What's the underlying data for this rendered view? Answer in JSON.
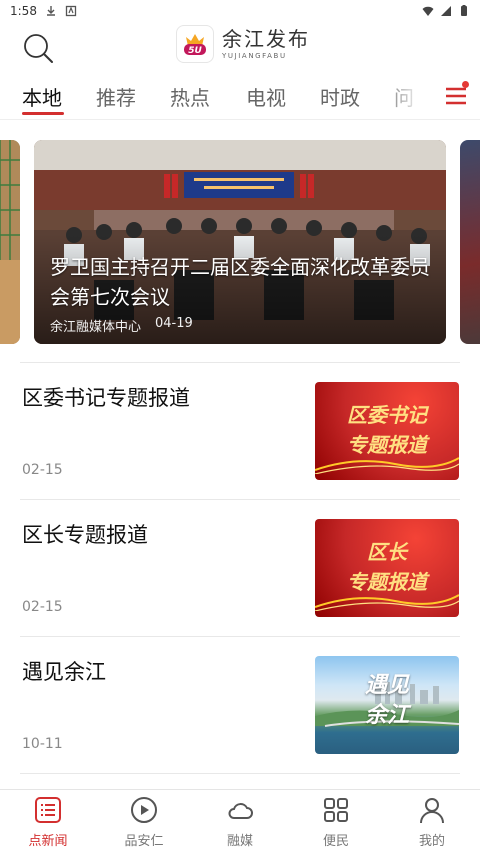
{
  "status_bar": {
    "time": "1:58"
  },
  "header": {
    "app_name": "余江发布",
    "app_subtitle": "YUJIANGFABU",
    "logo_text": "5U"
  },
  "tabs": [
    {
      "label": "本地",
      "active": true
    },
    {
      "label": "推荐",
      "active": false
    },
    {
      "label": "热点",
      "active": false
    },
    {
      "label": "电视",
      "active": false
    },
    {
      "label": "时政",
      "active": false
    },
    {
      "label": "问",
      "active": false
    }
  ],
  "hero": {
    "title": "罗卫国主持召开二届区委全面深化改革委员会第七次会议",
    "source": "余江融媒体中心",
    "date": "04-19"
  },
  "news": [
    {
      "title": "区委书记专题报道",
      "date": "02-15",
      "thumb_lines": [
        "区委书记",
        "专题报道"
      ]
    },
    {
      "title": "区长专题报道",
      "date": "02-15",
      "thumb_lines": [
        "区长",
        "专题报道"
      ]
    },
    {
      "title": "遇见余江",
      "date": "10-11",
      "thumb_lines": [
        "遇见",
        "余江"
      ]
    }
  ],
  "bottom_nav": [
    {
      "label": "点新闻",
      "icon": "news-list-icon",
      "active": true
    },
    {
      "label": "品安仁",
      "icon": "play-circle-icon",
      "active": false
    },
    {
      "label": "融媒",
      "icon": "cloud-icon",
      "active": false
    },
    {
      "label": "便民",
      "icon": "grid-icon",
      "active": false
    },
    {
      "label": "我的",
      "icon": "person-icon",
      "active": false
    }
  ],
  "colors": {
    "accent": "#d32f2f",
    "tab_inactive": "#666666",
    "date_gray": "#888888"
  }
}
